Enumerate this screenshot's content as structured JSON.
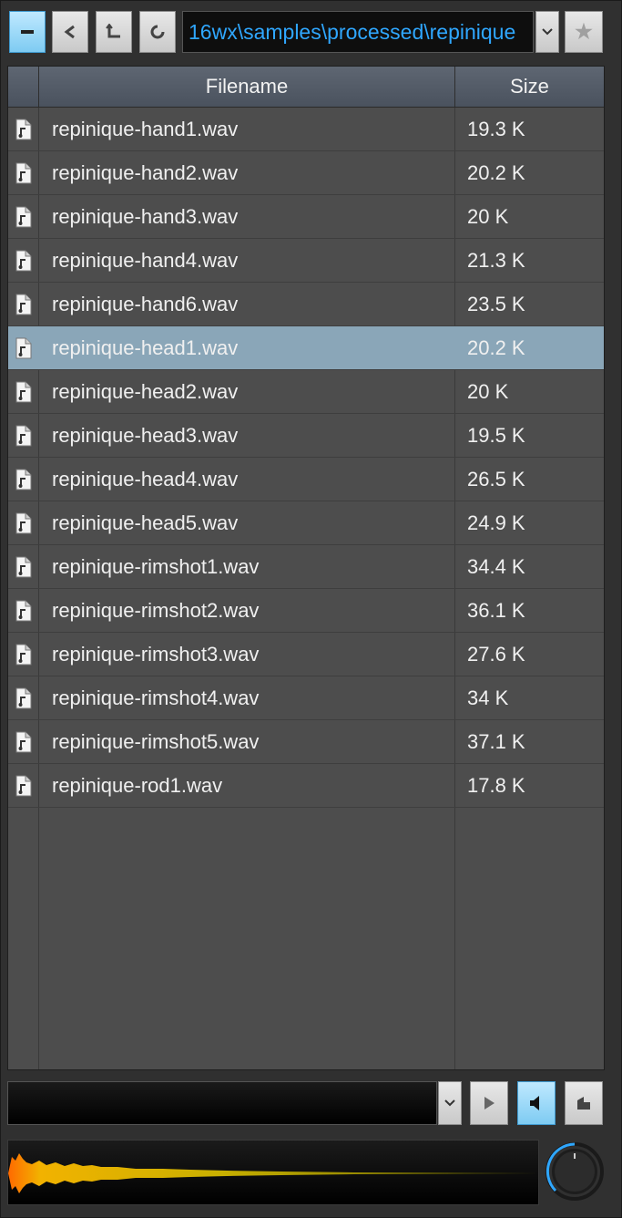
{
  "toolbar": {
    "collapse_icon": "minus-icon",
    "back_icon": "back-arrow-icon",
    "up_icon": "parent-folder-icon",
    "refresh_icon": "refresh-icon",
    "path": "16wx\\samples\\processed\\repinique",
    "path_dropdown_icon": "chevron-down-icon",
    "favorite_icon": "star-icon"
  },
  "list": {
    "columns": [
      "Filename",
      "Size"
    ],
    "rows": [
      {
        "name": "repinique-hand1.wav",
        "size": "19.3 K"
      },
      {
        "name": "repinique-hand2.wav",
        "size": "20.2 K"
      },
      {
        "name": "repinique-hand3.wav",
        "size": "20 K"
      },
      {
        "name": "repinique-hand4.wav",
        "size": "21.3 K"
      },
      {
        "name": "repinique-hand6.wav",
        "size": "23.5 K"
      },
      {
        "name": "repinique-head1.wav",
        "size": "20.2 K",
        "selected": true
      },
      {
        "name": "repinique-head2.wav",
        "size": "20 K"
      },
      {
        "name": "repinique-head3.wav",
        "size": "19.5 K"
      },
      {
        "name": "repinique-head4.wav",
        "size": "26.5 K"
      },
      {
        "name": "repinique-head5.wav",
        "size": "24.9 K"
      },
      {
        "name": "repinique-rimshot1.wav",
        "size": "34.4 K"
      },
      {
        "name": "repinique-rimshot2.wav",
        "size": "36.1 K"
      },
      {
        "name": "repinique-rimshot3.wav",
        "size": "27.6 K"
      },
      {
        "name": "repinique-rimshot4.wav",
        "size": "34 K"
      },
      {
        "name": "repinique-rimshot5.wav",
        "size": "37.1 K"
      },
      {
        "name": "repinique-rod1.wav",
        "size": "17.8 K"
      }
    ]
  },
  "player": {
    "dropdown_icon": "chevron-down-icon",
    "play_icon": "play-icon",
    "speaker_icon": "speaker-icon",
    "autoplay_icon": "autoplay-icon",
    "knob_icon": "volume-knob-icon"
  },
  "colors": {
    "accent": "#2fa7ff",
    "selected_row": "#8aa6b8",
    "waveform": "#e8c200"
  }
}
